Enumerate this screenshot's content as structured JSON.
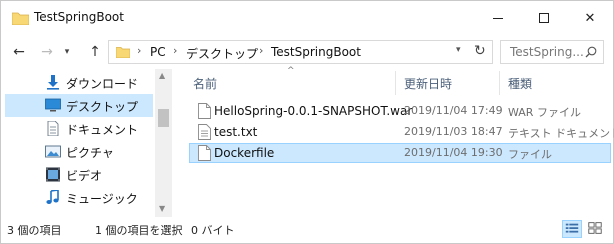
{
  "window": {
    "title": "TestSpringBoot",
    "minimize_icon": "minimize-icon",
    "maximize_icon": "maximize-icon",
    "close_glyph": "✕"
  },
  "nav": {
    "back_glyph": "←",
    "forward_glyph": "→",
    "recent_glyph": "▾",
    "up_glyph": "↑"
  },
  "address": {
    "crumbs": [
      "PC",
      "デスクトップ",
      "TestSpringBoot"
    ],
    "separator": "›",
    "dropdown_glyph": "▾",
    "refresh_glyph": "↻"
  },
  "search": {
    "placeholder": "TestSpring..."
  },
  "sidebar": {
    "items": [
      {
        "label": "ダウンロード",
        "icon": "download-icon",
        "selected": false
      },
      {
        "label": "デスクトップ",
        "icon": "desktop-icon",
        "selected": true
      },
      {
        "label": "ドキュメント",
        "icon": "document-icon",
        "selected": false
      },
      {
        "label": "ピクチャ",
        "icon": "picture-icon",
        "selected": false
      },
      {
        "label": "ビデオ",
        "icon": "video-icon",
        "selected": false
      },
      {
        "label": "ミュージック",
        "icon": "music-icon",
        "selected": false
      }
    ]
  },
  "filelist": {
    "columns": {
      "name": "名前",
      "date": "更新日時",
      "type": "種類"
    },
    "sort_glyph": "^",
    "rows": [
      {
        "name": "HelloSpring-0.0.1-SNAPSHOT.war",
        "date": "2019/11/04 17:49",
        "type": "WAR ファイル",
        "selected": false
      },
      {
        "name": "test.txt",
        "date": "2019/11/03 18:47",
        "type": "テキスト ドキュメント",
        "selected": false
      },
      {
        "name": "Dockerfile",
        "date": "2019/11/04 19:30",
        "type": "ファイル",
        "selected": true
      }
    ]
  },
  "status": {
    "item_count": "3 個の項目",
    "selection": "1 個の項目を選択",
    "size": "0 バイト"
  },
  "colors": {
    "selection_bg": "#cce8ff",
    "selection_border": "#99d1ff",
    "folder_yellow": "#f8d775",
    "header_text": "#4c607a"
  }
}
